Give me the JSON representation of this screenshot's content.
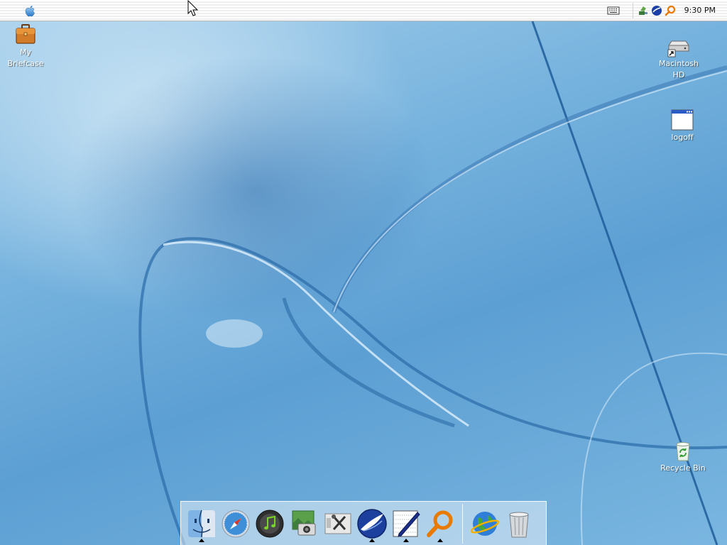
{
  "menubar": {
    "clock": "9:30 PM",
    "tray_icons": [
      "network-icon",
      "browser-icon",
      "search-icon"
    ]
  },
  "desktop": {
    "icons": [
      {
        "name": "briefcase",
        "label": "My\nBriefcase"
      },
      {
        "name": "macintosh-hd",
        "label": "Macintosh\nHD"
      },
      {
        "name": "logoff",
        "label": "logoff"
      },
      {
        "name": "recycle-bin",
        "label": "Recycle Bin"
      }
    ]
  },
  "dock": {
    "items": [
      {
        "icon": "finder-icon",
        "running": true
      },
      {
        "icon": "safari-icon",
        "running": false
      },
      {
        "icon": "itunes-icon",
        "running": false
      },
      {
        "icon": "iphoto-icon",
        "running": false
      },
      {
        "icon": "system-tools-icon",
        "running": false
      },
      {
        "icon": "seamonkey-icon",
        "running": true
      },
      {
        "icon": "text-editor-icon",
        "running": true
      },
      {
        "icon": "search-magnifier-icon",
        "running": true
      },
      {
        "icon": "internet-globe-icon",
        "running": false
      },
      {
        "icon": "trash-icon",
        "running": false
      }
    ]
  },
  "colors": {
    "desktop_base": "#6aaade",
    "menubar": "#f5f5f5",
    "label_text": "#ffffff"
  }
}
